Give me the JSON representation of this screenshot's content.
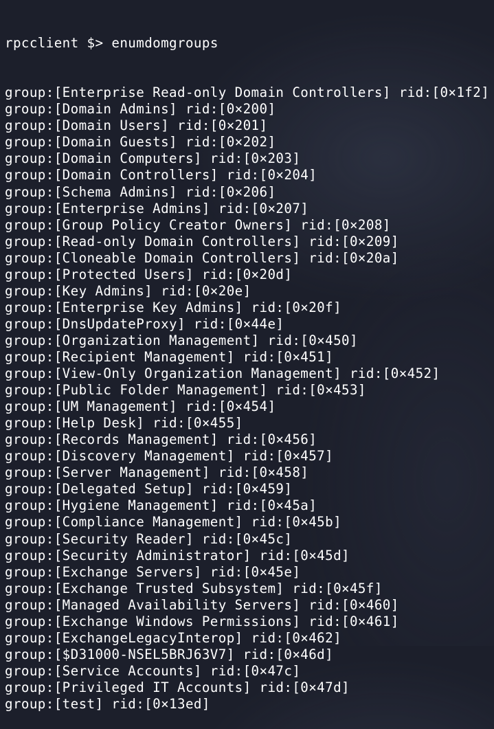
{
  "terminal": {
    "prompt": {
      "program": "rpcclient",
      "symbol": "$>",
      "command": "enumdomgroups"
    },
    "lines": [
      "group:[Enterprise Read-only Domain Controllers] rid:[0×1f2]",
      "group:[Domain Admins] rid:[0×200]",
      "group:[Domain Users] rid:[0×201]",
      "group:[Domain Guests] rid:[0×202]",
      "group:[Domain Computers] rid:[0×203]",
      "group:[Domain Controllers] rid:[0×204]",
      "group:[Schema Admins] rid:[0×206]",
      "group:[Enterprise Admins] rid:[0×207]",
      "group:[Group Policy Creator Owners] rid:[0×208]",
      "group:[Read-only Domain Controllers] rid:[0×209]",
      "group:[Cloneable Domain Controllers] rid:[0×20a]",
      "group:[Protected Users] rid:[0×20d]",
      "group:[Key Admins] rid:[0×20e]",
      "group:[Enterprise Key Admins] rid:[0×20f]",
      "group:[DnsUpdateProxy] rid:[0×44e]",
      "group:[Organization Management] rid:[0×450]",
      "group:[Recipient Management] rid:[0×451]",
      "group:[View-Only Organization Management] rid:[0×452]",
      "group:[Public Folder Management] rid:[0×453]",
      "group:[UM Management] rid:[0×454]",
      "group:[Help Desk] rid:[0×455]",
      "group:[Records Management] rid:[0×456]",
      "group:[Discovery Management] rid:[0×457]",
      "group:[Server Management] rid:[0×458]",
      "group:[Delegated Setup] rid:[0×459]",
      "group:[Hygiene Management] rid:[0×45a]",
      "group:[Compliance Management] rid:[0×45b]",
      "group:[Security Reader] rid:[0×45c]",
      "group:[Security Administrator] rid:[0×45d]",
      "group:[Exchange Servers] rid:[0×45e]",
      "group:[Exchange Trusted Subsystem] rid:[0×45f]",
      "group:[Managed Availability Servers] rid:[0×460]",
      "group:[Exchange Windows Permissions] rid:[0×461]",
      "group:[ExchangeLegacyInterop] rid:[0×462]",
      "group:[$D31000-NSEL5BRJ63V7] rid:[0×46d]",
      "group:[Service Accounts] rid:[0×47c]",
      "group:[Privileged IT Accounts] rid:[0×47d]",
      "group:[test] rid:[0×13ed]"
    ]
  }
}
